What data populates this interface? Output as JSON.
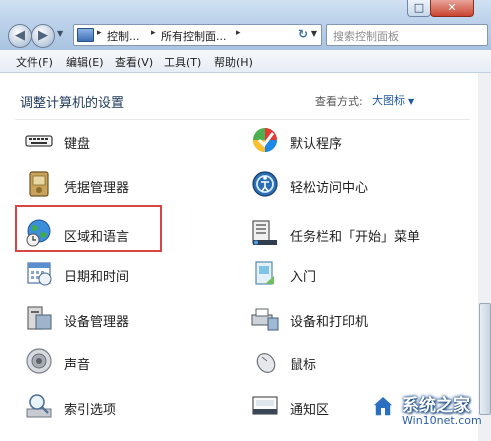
{
  "address_bar": {
    "crumbs": [
      "控制...",
      "所有控制面...",
      ""
    ],
    "search_placeholder": "搜索控制面板"
  },
  "menu": {
    "items": [
      "文件(F)",
      "编辑(E)",
      "查看(V)",
      "工具(T)",
      "帮助(H)"
    ]
  },
  "content": {
    "heading": "调整计算机的设置",
    "view_by_label": "查看方式:",
    "view_by_value": "大图标"
  },
  "items_left": [
    {
      "label": "键盘",
      "icon": "keyboard-icon"
    },
    {
      "label": "凭据管理器",
      "icon": "credential-manager-icon"
    },
    {
      "label": "区域和语言",
      "icon": "region-language-icon"
    },
    {
      "label": "日期和时间",
      "icon": "date-time-icon"
    },
    {
      "label": "设备管理器",
      "icon": "device-manager-icon"
    },
    {
      "label": "声音",
      "icon": "sound-icon"
    },
    {
      "label": "索引选项",
      "icon": "indexing-options-icon"
    }
  ],
  "items_right": [
    {
      "label": "默认程序",
      "icon": "default-programs-icon"
    },
    {
      "label": "轻松访问中心",
      "icon": "ease-of-access-icon"
    },
    {
      "label": "任务栏和「开始」菜单",
      "icon": "taskbar-start-menu-icon"
    },
    {
      "label": "入门",
      "icon": "getting-started-icon"
    },
    {
      "label": "设备和打印机",
      "icon": "devices-printers-icon"
    },
    {
      "label": "鼠标",
      "icon": "mouse-icon"
    },
    {
      "label": "通知区",
      "icon": "notification-area-icon"
    }
  ],
  "watermark": {
    "title": "系统之家",
    "url": "Win10net.com"
  },
  "colors": {
    "highlight": "#d94545",
    "link": "#1e5aa0"
  }
}
